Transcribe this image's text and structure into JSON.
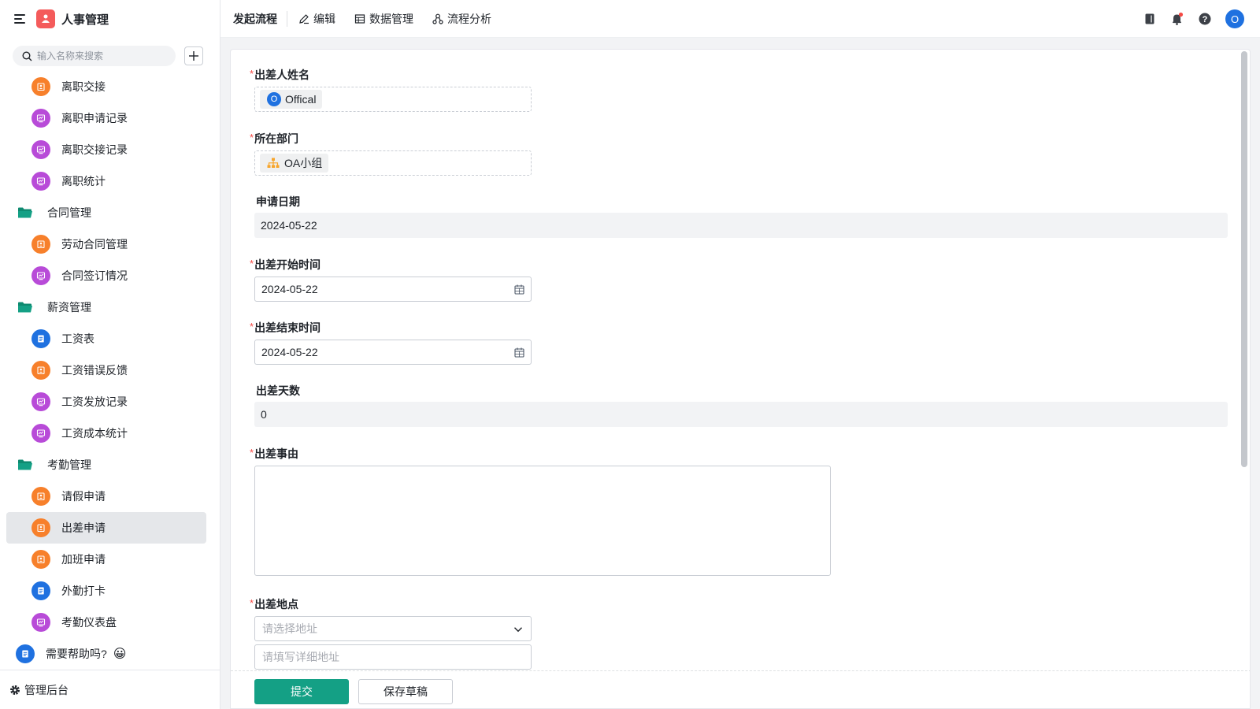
{
  "app": {
    "title": "人事管理"
  },
  "sidebar": {
    "search_placeholder": "输入名称来搜索",
    "items": [
      {
        "label": "离职交接",
        "icon": "form-icon",
        "color": "#f7802b"
      },
      {
        "label": "离职申请记录",
        "icon": "report-icon",
        "color": "#b84bd8"
      },
      {
        "label": "离职交接记录",
        "icon": "report-icon",
        "color": "#b84bd8"
      },
      {
        "label": "离职统计",
        "icon": "report-icon",
        "color": "#b84bd8"
      },
      {
        "label": "合同管理",
        "icon": "folder-icon",
        "color": "#14a085"
      },
      {
        "label": "劳动合同管理",
        "icon": "form-icon",
        "color": "#f7802b"
      },
      {
        "label": "合同签订情况",
        "icon": "report-icon",
        "color": "#b84bd8"
      },
      {
        "label": "薪资管理",
        "icon": "folder-icon",
        "color": "#14a085"
      },
      {
        "label": "工资表",
        "icon": "sheet-icon",
        "color": "#1f71e0"
      },
      {
        "label": "工资错误反馈",
        "icon": "form-icon",
        "color": "#f7802b"
      },
      {
        "label": "工资发放记录",
        "icon": "report-icon",
        "color": "#b84bd8"
      },
      {
        "label": "工资成本统计",
        "icon": "report-icon",
        "color": "#b84bd8"
      },
      {
        "label": "考勤管理",
        "icon": "folder-icon",
        "color": "#14a085"
      },
      {
        "label": "请假申请",
        "icon": "form-icon",
        "color": "#f7802b"
      },
      {
        "label": "出差申请",
        "icon": "form-icon",
        "color": "#f7802b",
        "active": true
      },
      {
        "label": "加班申请",
        "icon": "form-icon",
        "color": "#f7802b"
      },
      {
        "label": "外勤打卡",
        "icon": "sheet-icon",
        "color": "#1f71e0"
      },
      {
        "label": "考勤仪表盘",
        "icon": "report-icon",
        "color": "#b84bd8"
      },
      {
        "label": "需要帮助吗?",
        "icon": "sheet-icon",
        "color": "#1f71e0",
        "emoji": "😀"
      }
    ],
    "footer_label": "管理后台"
  },
  "topbar": {
    "start_flow": "发起流程",
    "edit": "编辑",
    "data_manage": "数据管理",
    "flow_analysis": "流程分析",
    "avatar_letter": "O"
  },
  "form": {
    "applicant": {
      "label": "出差人姓名",
      "value": "Offical",
      "avatar": "O"
    },
    "department": {
      "label": "所在部门",
      "value": "OA小组"
    },
    "apply_date": {
      "label": "申请日期",
      "value": "2024-05-22"
    },
    "start_time": {
      "label": "出差开始时间",
      "value": "2024-05-22"
    },
    "end_time": {
      "label": "出差结束时间",
      "value": "2024-05-22"
    },
    "days": {
      "label": "出差天数",
      "value": "0"
    },
    "reason": {
      "label": "出差事由",
      "value": ""
    },
    "location": {
      "label": "出差地点",
      "select_placeholder": "请选择地址",
      "detail_placeholder": "请填写详细地址"
    }
  },
  "actions": {
    "submit": "提交",
    "save_draft": "保存草稿"
  },
  "colors": {
    "primary": "#14a085",
    "required": "#f54a45",
    "accent_blue": "#1f71e0"
  }
}
